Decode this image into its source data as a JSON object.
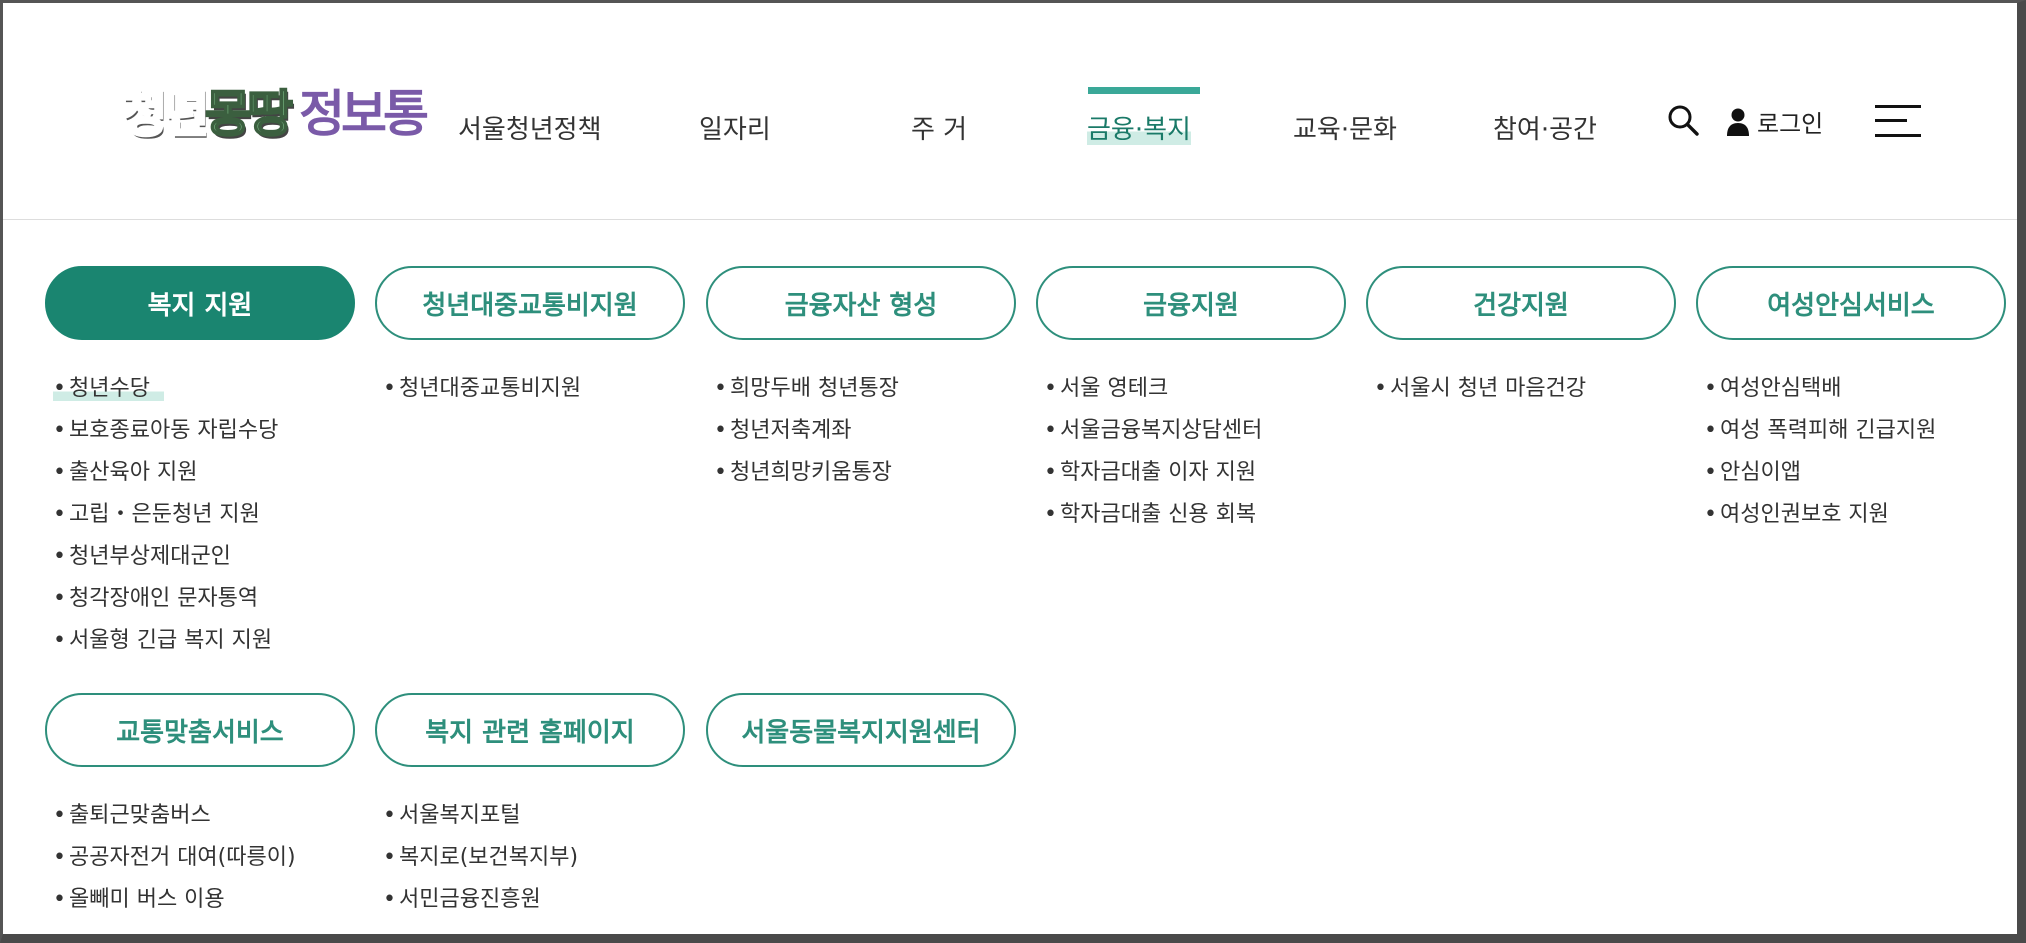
{
  "logo": {
    "part1": "청년",
    "part2": "몽땅",
    "part3": "정보통"
  },
  "nav": [
    {
      "label": "서울청년정책"
    },
    {
      "label": "일자리"
    },
    {
      "label": "주 거"
    },
    {
      "label": "금융·복지"
    },
    {
      "label": "교육·문화"
    },
    {
      "label": "참여·공간"
    }
  ],
  "header": {
    "login_label": "로그인",
    "accent_color": "#3aa898"
  },
  "categories": [
    {
      "label": "복지 지원",
      "items": [
        "청년수당",
        "보호종료아동 자립수당",
        "출산육아 지원",
        "고립・은둔청년 지원",
        "청년부상제대군인",
        "청각장애인 문자통역",
        "서울형 긴급 복지 지원"
      ]
    },
    {
      "label": "청년대중교통비지원",
      "items": [
        "청년대중교통비지원"
      ]
    },
    {
      "label": "금융자산 형성",
      "items": [
        "희망두배 청년통장",
        "청년저축계좌",
        "청년희망키움통장"
      ]
    },
    {
      "label": "금융지원",
      "items": [
        "서울 영테크",
        "서울금융복지상담센터",
        "학자금대출 이자 지원",
        "학자금대출 신용 회복"
      ]
    },
    {
      "label": "건강지원",
      "items": [
        "서울시 청년 마음건강"
      ]
    },
    {
      "label": "여성안심서비스",
      "items": [
        "여성안심택배",
        "여성 폭력피해 긴급지원",
        "안심이앱",
        "여성인권보호 지원"
      ]
    },
    {
      "label": "교통맞춤서비스",
      "items": [
        "출퇴근맞춤버스",
        "공공자전거 대여(따릉이)",
        "올빼미 버스 이용"
      ]
    },
    {
      "label": "복지 관련 홈페이지",
      "items": [
        "서울복지포털",
        "복지로(보건복지부)",
        "서민금융진흥원"
      ]
    },
    {
      "label": "서울동물복지지원센터",
      "items": []
    }
  ],
  "colors": {
    "primary": "#1a8570",
    "highlight": "#cfece5",
    "text": "#333333"
  }
}
